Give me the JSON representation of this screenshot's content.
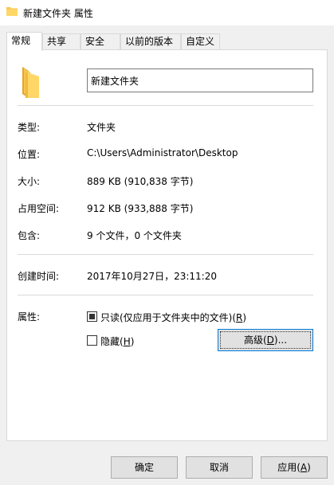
{
  "window": {
    "title": "新建文件夹 属性"
  },
  "tabs": [
    {
      "label": "常规",
      "active": true
    },
    {
      "label": "共享",
      "active": false
    },
    {
      "label": "安全",
      "active": false
    },
    {
      "label": "以前的版本",
      "active": false
    },
    {
      "label": "自定义",
      "active": false
    }
  ],
  "general": {
    "folder_name": "新建文件夹",
    "type_label": "类型:",
    "type_value": "文件夹",
    "location_label": "位置:",
    "location_value": "C:\\Users\\Administrator\\Desktop",
    "size_label": "大小:",
    "size_value": "889 KB (910,838 字节)",
    "disk_size_label": "占用空间:",
    "disk_size_value": "912 KB (933,888 字节)",
    "contains_label": "包含:",
    "contains_value": "9 个文件，0 个文件夹",
    "created_label": "创建时间:",
    "created_value": "2017年10月27日，23:11:20",
    "attributes_label": "属性:",
    "readonly_text": "只读(仅应用于文件夹中的文件)(",
    "readonly_key": "R",
    "readonly_end": ")",
    "readonly_state": "indeterminate",
    "hidden_text": "隐藏(",
    "hidden_key": "H",
    "hidden_end": ")",
    "hidden_state": "unchecked",
    "advanced_text": "高级(",
    "advanced_key": "D",
    "advanced_end": ")..."
  },
  "footer": {
    "ok": "确定",
    "cancel": "取消",
    "apply_text": "应用(",
    "apply_key": "A",
    "apply_end": ")"
  },
  "colors": {
    "folder": "#f7c64f",
    "folder_dark": "#e3a52b",
    "focus_border": "#0078d7"
  }
}
